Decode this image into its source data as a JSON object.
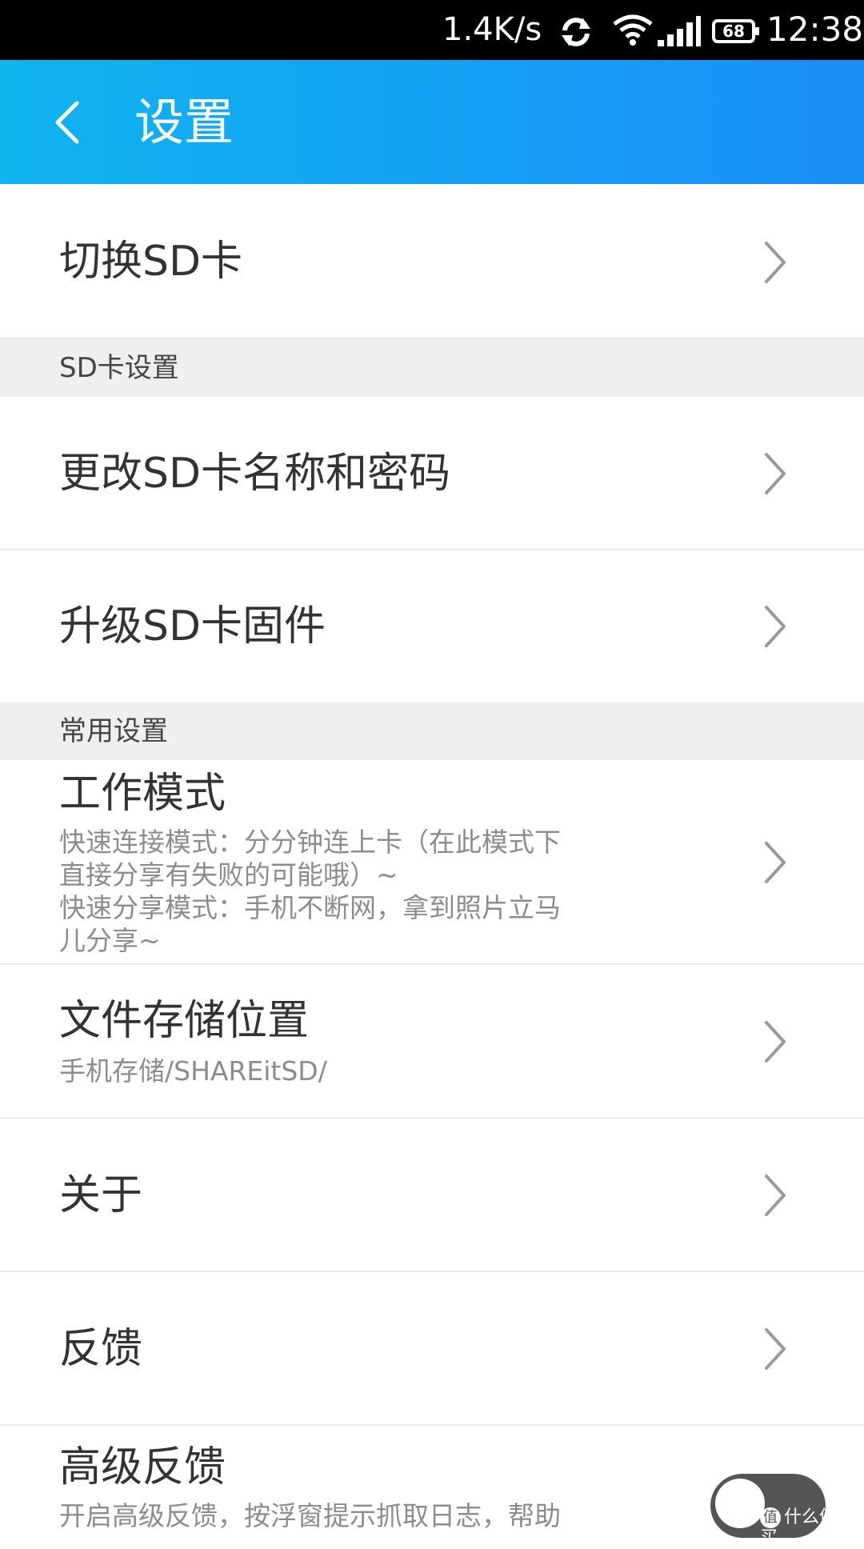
{
  "status_bar": {
    "net_speed": "1.4K/s",
    "battery": "68",
    "time": "12:38",
    "icons": [
      "sync-icon",
      "wifi-icon",
      "signal-icon",
      "battery-icon"
    ]
  },
  "app_bar": {
    "title": "设置",
    "back_icon": "back-arrow-icon",
    "gradient": [
      "#0fb4f0",
      "#1a8ef7"
    ]
  },
  "items": {
    "switch_sd": {
      "label": "切换SD卡"
    },
    "section_sd": {
      "label": "SD卡设置"
    },
    "rename_sd": {
      "label": "更改SD卡名称和密码"
    },
    "upgrade_sd": {
      "label": "升级SD卡固件"
    },
    "section_common": {
      "label": "常用设置"
    },
    "work_mode": {
      "label": "工作模式",
      "desc_1": "快速连接模式：分分钟连上卡（在此模式下",
      "desc_2": "直接分享有失败的可能哦）~",
      "desc_3": "快速分享模式：手机不断网，拿到照片立马",
      "desc_4": "儿分享~"
    },
    "storage": {
      "label": "文件存储位置",
      "desc": "手机存储/SHAREitSD/"
    },
    "about": {
      "label": "关于"
    },
    "feedback": {
      "label": "反馈"
    },
    "advanced_feedback": {
      "label": "高级反馈",
      "desc": "开启高级反馈，按浮窗提示抓取日志，帮助",
      "toggle_on": false
    }
  },
  "watermark": {
    "badge": "值",
    "text": "什么值得买"
  }
}
